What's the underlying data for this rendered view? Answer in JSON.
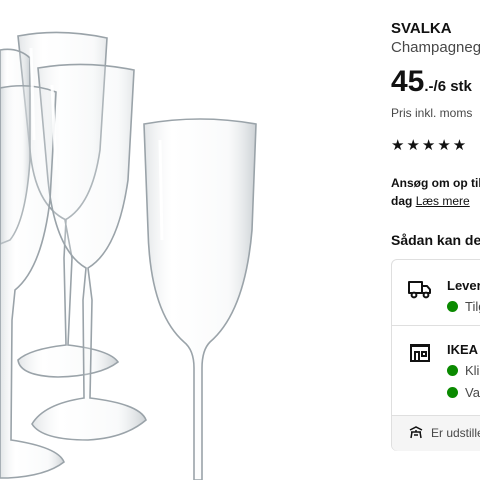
{
  "product": {
    "name": "SVALKA",
    "description": "Champagneglas",
    "price_integer": "45",
    "price_suffix": ".-/6 stk",
    "vat_note": "Pris inkl. moms",
    "rating_stars": "★★★★★",
    "apply_text": "Ansøg om op til",
    "apply_text_2": "dag",
    "apply_link": "Læs mere"
  },
  "availability": {
    "title": "Sådan kan de",
    "delivery": {
      "title": "Levering",
      "status": "Tilgængelig"
    },
    "store": {
      "title": "IKEA",
      "status_1": "Klik",
      "status_2": "Varer"
    },
    "footer_text": "Er udstillet"
  },
  "colors": {
    "available_dot": "#0a8a00",
    "text": "#111111",
    "muted": "#484848"
  },
  "icons": {
    "delivery": "truck-icon",
    "store": "store-icon",
    "footer": "display-icon"
  }
}
